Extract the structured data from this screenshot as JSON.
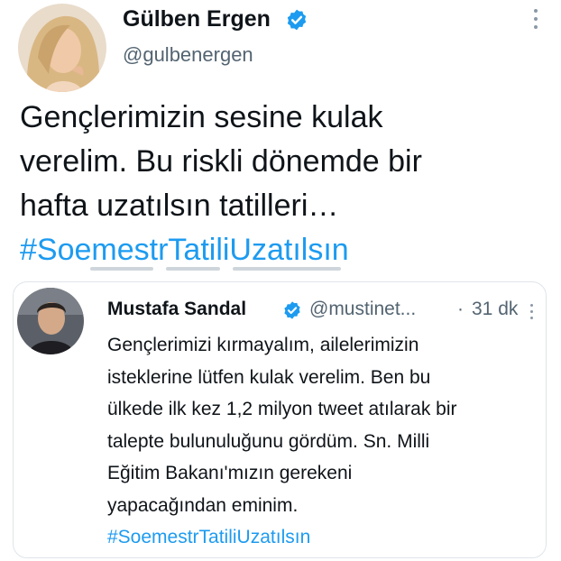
{
  "main_tweet": {
    "author_name": "Gülben Ergen",
    "author_handle": "@gulbenergen",
    "verified_icon": "verified-badge-icon",
    "more_icon": "more-vertical-icon",
    "text_lines": [
      "Gençlerimizin sesine kulak",
      "verelim. Bu riskli dönemde bir",
      "hafta uzatılsın tatilleri…"
    ],
    "hashtag": "#SoemestrTatiliUzatılsın"
  },
  "quoted_tweet": {
    "author_name": "Mustafa Sandal",
    "author_handle": "@mustinet...",
    "separator": "·",
    "time": "31 dk",
    "verified_icon": "verified-badge-icon",
    "more_icon": "more-vertical-icon",
    "text_lines": [
      "Gençlerimizi kırmayalım, ailelerimizin",
      "isteklerine lütfen kulak verelim. Ben bu",
      "ülkede ilk kez 1,2 milyon tweet atılarak bir",
      "talepte bulunuluğunu gördüm. Sn. Milli",
      "Eğitim Bakanı'mızın gerekeni",
      "yapacağından eminim."
    ],
    "hashtag": "#SoemestrTatiliUzatılsın"
  },
  "colors": {
    "link": "#1d9bf0",
    "secondary_text": "#536471",
    "verified": "#1d9bf0",
    "border": "#dfe5ea"
  }
}
